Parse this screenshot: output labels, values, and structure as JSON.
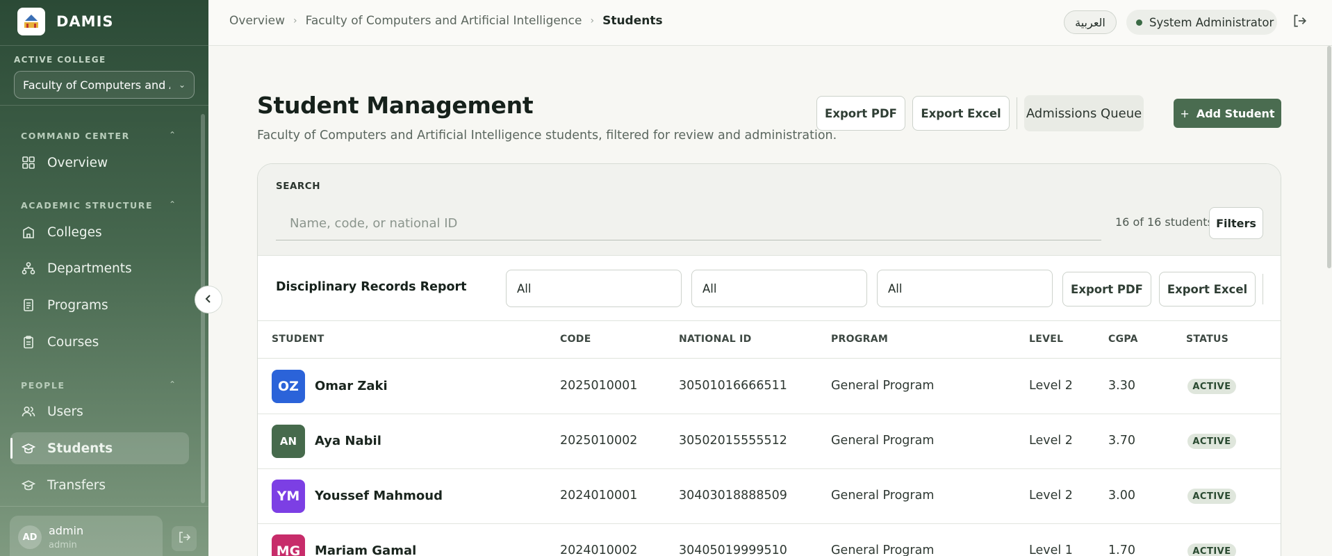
{
  "brand": {
    "name": "DAMIS"
  },
  "sidebar": {
    "active_college_label": "ACTIVE COLLEGE",
    "college_select_value": "Faculty of Computers and Artificial Intelligence",
    "sections": [
      {
        "label": "COMMAND CENTER",
        "items": [
          {
            "label": "Overview",
            "icon": "grid-icon"
          }
        ]
      },
      {
        "label": "ACADEMIC STRUCTURE",
        "items": [
          {
            "label": "Colleges",
            "icon": "building-icon"
          },
          {
            "label": "Departments",
            "icon": "hierarchy-icon"
          },
          {
            "label": "Programs",
            "icon": "document-icon"
          },
          {
            "label": "Courses",
            "icon": "clipboard-icon"
          }
        ]
      },
      {
        "label": "PEOPLE",
        "items": [
          {
            "label": "Users",
            "icon": "users-icon"
          },
          {
            "label": "Students",
            "icon": "graduation-cap-icon",
            "active": true
          },
          {
            "label": "Transfers",
            "icon": "graduation-cap-icon"
          }
        ]
      }
    ],
    "user": {
      "initials": "AD",
      "name": "admin",
      "role": "admin"
    }
  },
  "topbar": {
    "breadcrumbs": [
      "Overview",
      "Faculty of Computers and Artificial Intelligence",
      "Students"
    ],
    "language_button": "العربية",
    "role": "System Administrator"
  },
  "header": {
    "title": "Student Management",
    "subtitle": "Faculty of Computers and Artificial Intelligence students, filtered for review and administration.",
    "export_pdf": "Export PDF",
    "export_excel": "Export Excel",
    "admissions_queue": "Admissions Queue",
    "add_student": "Add Student",
    "add_icon": "+"
  },
  "search": {
    "label": "SEARCH",
    "placeholder": "Name, code, or national ID",
    "value": "",
    "count_text": "16 of 16 students",
    "filters_button": "Filters"
  },
  "report": {
    "title": "Disciplinary Records Report",
    "selects": [
      "All",
      "All",
      "All"
    ],
    "export_pdf": "Export PDF",
    "export_excel": "Export Excel"
  },
  "table": {
    "columns": [
      "STUDENT",
      "CODE",
      "NATIONAL ID",
      "PROGRAM",
      "LEVEL",
      "CGPA",
      "STATUS"
    ],
    "rows": [
      {
        "initials": "OZ",
        "avatar_color": "#2b63d9",
        "name": "Omar Zaki",
        "code": "2025010001",
        "national_id": "30501016666511",
        "program": "General Program",
        "level": "Level 2",
        "cgpa": "3.30",
        "status": "ACTIVE"
      },
      {
        "initials": "AN",
        "avatar_color": "#466a4c",
        "name": "Aya Nabil",
        "code": "2025010002",
        "national_id": "30502015555512",
        "program": "General Program",
        "level": "Level 2",
        "cgpa": "3.70",
        "status": "ACTIVE"
      },
      {
        "initials": "YM",
        "avatar_color": "#7c3fe4",
        "name": "Youssef Mahmoud",
        "code": "2024010001",
        "national_id": "30403018888509",
        "program": "General Program",
        "level": "Level 2",
        "cgpa": "3.00",
        "status": "ACTIVE"
      },
      {
        "initials": "MG",
        "avatar_color": "#c72c6a",
        "name": "Mariam Gamal",
        "code": "2024010002",
        "national_id": "30405019999510",
        "program": "General Program",
        "level": "Level 1",
        "cgpa": "1.70",
        "status": "ACTIVE"
      }
    ]
  },
  "colors": {
    "accent": "#4a6c50",
    "sidebar_top": "#2b4a36",
    "badge_bg": "#dfe6dc"
  }
}
